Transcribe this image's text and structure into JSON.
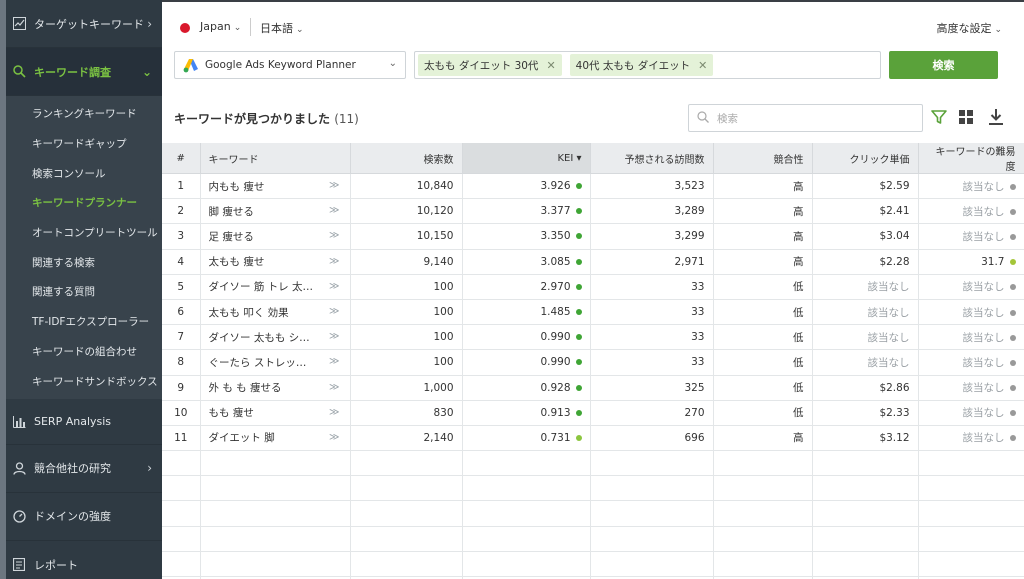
{
  "sidebar": {
    "top": {
      "label": "ターゲットキーワード",
      "icon": "chart-icon"
    },
    "active": {
      "label": "キーワード調査",
      "icon": "search-icon"
    },
    "subitems": [
      {
        "label": "ランキングキーワード"
      },
      {
        "label": "キーワードギャップ"
      },
      {
        "label": "検索コンソール"
      },
      {
        "label": "キーワードプランナー",
        "active": true
      },
      {
        "label": "オートコンプリートツール"
      },
      {
        "label": "関連する検索"
      },
      {
        "label": "関連する質問"
      },
      {
        "label": "TF-IDFエクスプローラー"
      },
      {
        "label": "キーワードの組合わせ"
      },
      {
        "label": "キーワードサンドボックス"
      }
    ],
    "bottom": [
      {
        "label": "SERP Analysis",
        "icon": "bar-chart-icon"
      },
      {
        "label": "競合他社の研究",
        "icon": "user-icon"
      },
      {
        "label": "ドメインの強度",
        "icon": "gauge-icon"
      },
      {
        "label": "レポート",
        "icon": "report-icon"
      }
    ]
  },
  "topbar": {
    "country": "Japan",
    "language": "日本語",
    "advanced": "高度な設定"
  },
  "search": {
    "source": "Google Ads Keyword Planner",
    "tags": [
      "太もも ダイエット 30代",
      "40代 太もも ダイエット"
    ],
    "button": "検索"
  },
  "results": {
    "title": "キーワードが見つかりました",
    "count": "(11)",
    "filter_placeholder": "検索"
  },
  "table": {
    "columns": [
      "#",
      "キーワード",
      "検索数",
      "KEI",
      "予想される訪問数",
      "競合性",
      "クリック単価",
      "キーワードの難易度"
    ],
    "sort_indicator": "▾",
    "rows": [
      {
        "n": "1",
        "kw": "内もも 痩せ",
        "vol": "10,840",
        "kei": "3.926",
        "visits": "3,523",
        "comp": "高",
        "cpc": "$2.59",
        "diff": "該当なし"
      },
      {
        "n": "2",
        "kw": "脚 痩せる",
        "vol": "10,120",
        "kei": "3.377",
        "visits": "3,289",
        "comp": "高",
        "cpc": "$2.41",
        "diff": "該当なし"
      },
      {
        "n": "3",
        "kw": "足 痩せる",
        "vol": "10,150",
        "kei": "3.350",
        "visits": "3,299",
        "comp": "高",
        "cpc": "$3.04",
        "diff": "該当なし"
      },
      {
        "n": "4",
        "kw": "太もも 痩せ",
        "vol": "9,140",
        "kei": "3.085",
        "visits": "2,971",
        "comp": "高",
        "cpc": "$2.28",
        "diff": "31.7"
      },
      {
        "n": "5",
        "kw": "ダイソー 筋 トレ 太…",
        "vol": "100",
        "kei": "2.970",
        "visits": "33",
        "comp": "低",
        "cpc": "該当なし",
        "diff": "該当なし"
      },
      {
        "n": "6",
        "kw": "太もも 叩く 効果",
        "vol": "100",
        "kei": "1.485",
        "visits": "33",
        "comp": "低",
        "cpc": "該当なし",
        "diff": "該当なし"
      },
      {
        "n": "7",
        "kw": "ダイソー 太もも シ…",
        "vol": "100",
        "kei": "0.990",
        "visits": "33",
        "comp": "低",
        "cpc": "該当なし",
        "diff": "該当なし"
      },
      {
        "n": "8",
        "kw": "ぐーたら ストレッ…",
        "vol": "100",
        "kei": "0.990",
        "visits": "33",
        "comp": "低",
        "cpc": "該当なし",
        "diff": "該当なし"
      },
      {
        "n": "9",
        "kw": "外 も も 痩せる",
        "vol": "1,000",
        "kei": "0.928",
        "visits": "325",
        "comp": "低",
        "cpc": "$2.86",
        "diff": "該当なし"
      },
      {
        "n": "10",
        "kw": "もも 痩せ",
        "vol": "830",
        "kei": "0.913",
        "visits": "270",
        "comp": "低",
        "cpc": "$2.33",
        "diff": "該当なし"
      },
      {
        "n": "11",
        "kw": "ダイエット 脚",
        "vol": "2,140",
        "kei": "0.731",
        "visits": "696",
        "comp": "高",
        "cpc": "$3.12",
        "diff": "該当なし"
      }
    ]
  },
  "colors": {
    "accent": "#5aa23a",
    "kei_dot": "#3fa535",
    "kei_dot_light": "#8cc63f",
    "na_dot": "#999999",
    "diff_dot": "#a4c639"
  }
}
